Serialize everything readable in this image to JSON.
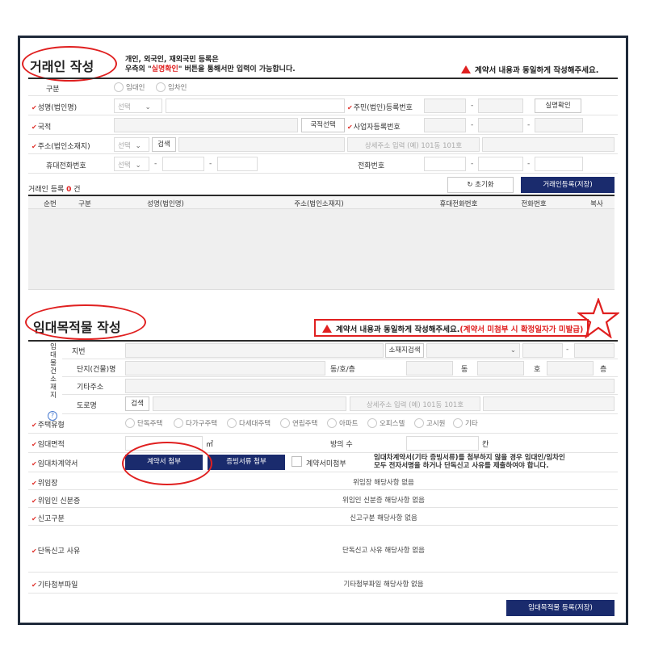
{
  "section1": {
    "title": "거래인 작성",
    "notice_line1": "개인, 외국인, 재외국민 등록은",
    "notice_line2_pre": "우측의 \"",
    "notice_line2_highlight": "실명확인",
    "notice_line2_post": "\" 버튼을 통해서만 입력이 가능합니다.",
    "warning": "계약서 내용과 동일하게 작성해주세요.",
    "fields": {
      "type_label": "구분",
      "type_options": [
        "임대인",
        "임차인"
      ],
      "name_label": "성명(법인명)",
      "name_select": "선택",
      "rrn_label": "주민(법인)등록번호",
      "verify_button": "실명확인",
      "nation_label": "국적",
      "nation_button": "국적선택",
      "bizno_label": "사업자등록번호",
      "address_label": "주소(법인소재지)",
      "address_select": "선택",
      "search_button": "검색",
      "address_detail_placeholder": "상세주소 입력 (예) 101동 101호",
      "mobile_label": "휴대전화번호",
      "mobile_select": "선택",
      "phone_label": "전화번호"
    },
    "reg_count_label": "거래인 등록",
    "reg_count_value": "0",
    "reg_count_unit": "건",
    "reset_button": "초기화",
    "save_button": "거래인등록(저장)",
    "table_headers": [
      "순번",
      "구분",
      "성명(법인명)",
      "주소(법인소재지)",
      "휴대전화번호",
      "전화번호",
      "복사"
    ]
  },
  "section2": {
    "title": "임대목적물 작성",
    "warning_pre": "계약서 내용과 동일하게 작성해주세요.",
    "warning_highlight": "(계약서 미첨부 시 확정일자가 미발급)",
    "side_label": "임대물건소재지",
    "location_label": "지번",
    "location_search_button": "소재지검색",
    "complex_label": "단지(건물)명",
    "dong_ho_label": "동/호/층",
    "dong_unit": "동",
    "ho_unit": "호",
    "floor_unit": "층",
    "other_address_label": "기타주소",
    "road_label": "도로명",
    "road_search_button": "검색",
    "road_detail_placeholder": "상세주소 입력 (예) 101동 101호",
    "house_type_label": "주택유형",
    "house_types": [
      "단독주택",
      "다가구주택",
      "다세대주택",
      "연립주택",
      "아파트",
      "오피스텔",
      "고시원",
      "기타"
    ],
    "area_label": "임대면적",
    "area_unit": "㎡",
    "rooms_label": "방의 수",
    "rooms_unit": "칸",
    "contract_label": "임대차계약서",
    "contract_attach_button": "계약서 첨부",
    "evidence_attach_button": "증빙서류 첨부",
    "no_contract_label": "계약서미첨부",
    "contract_note_line1": "임대차계약서(기타 증빙서류)를 첨부하지 않을 경우 임대인/임차인",
    "contract_note_line2": "모두 전자서명을 하거나 단독신고 사유를 제출하여야 합니다.",
    "proxy_label": "위임장",
    "proxy_value": "위임장 해당사항 없음",
    "proxy_id_label": "위임인 신분증",
    "proxy_id_value": "위임인 신분증 해당사항 없음",
    "report_type_label": "신고구분",
    "report_type_value": "신고구분 해당사항 없음",
    "solo_reason_label": "단독신고 사유",
    "solo_reason_value": "단독신고 사유 해당사항 없음",
    "other_file_label": "기타첨부파일",
    "other_file_value": "기타첨부파일 해당사항 없음",
    "save_button": "임대목적물 등록(저장)"
  },
  "colors": {
    "accent_red": "#e02020",
    "navy": "#1a2b6d",
    "frame": "#1f2a3a"
  }
}
